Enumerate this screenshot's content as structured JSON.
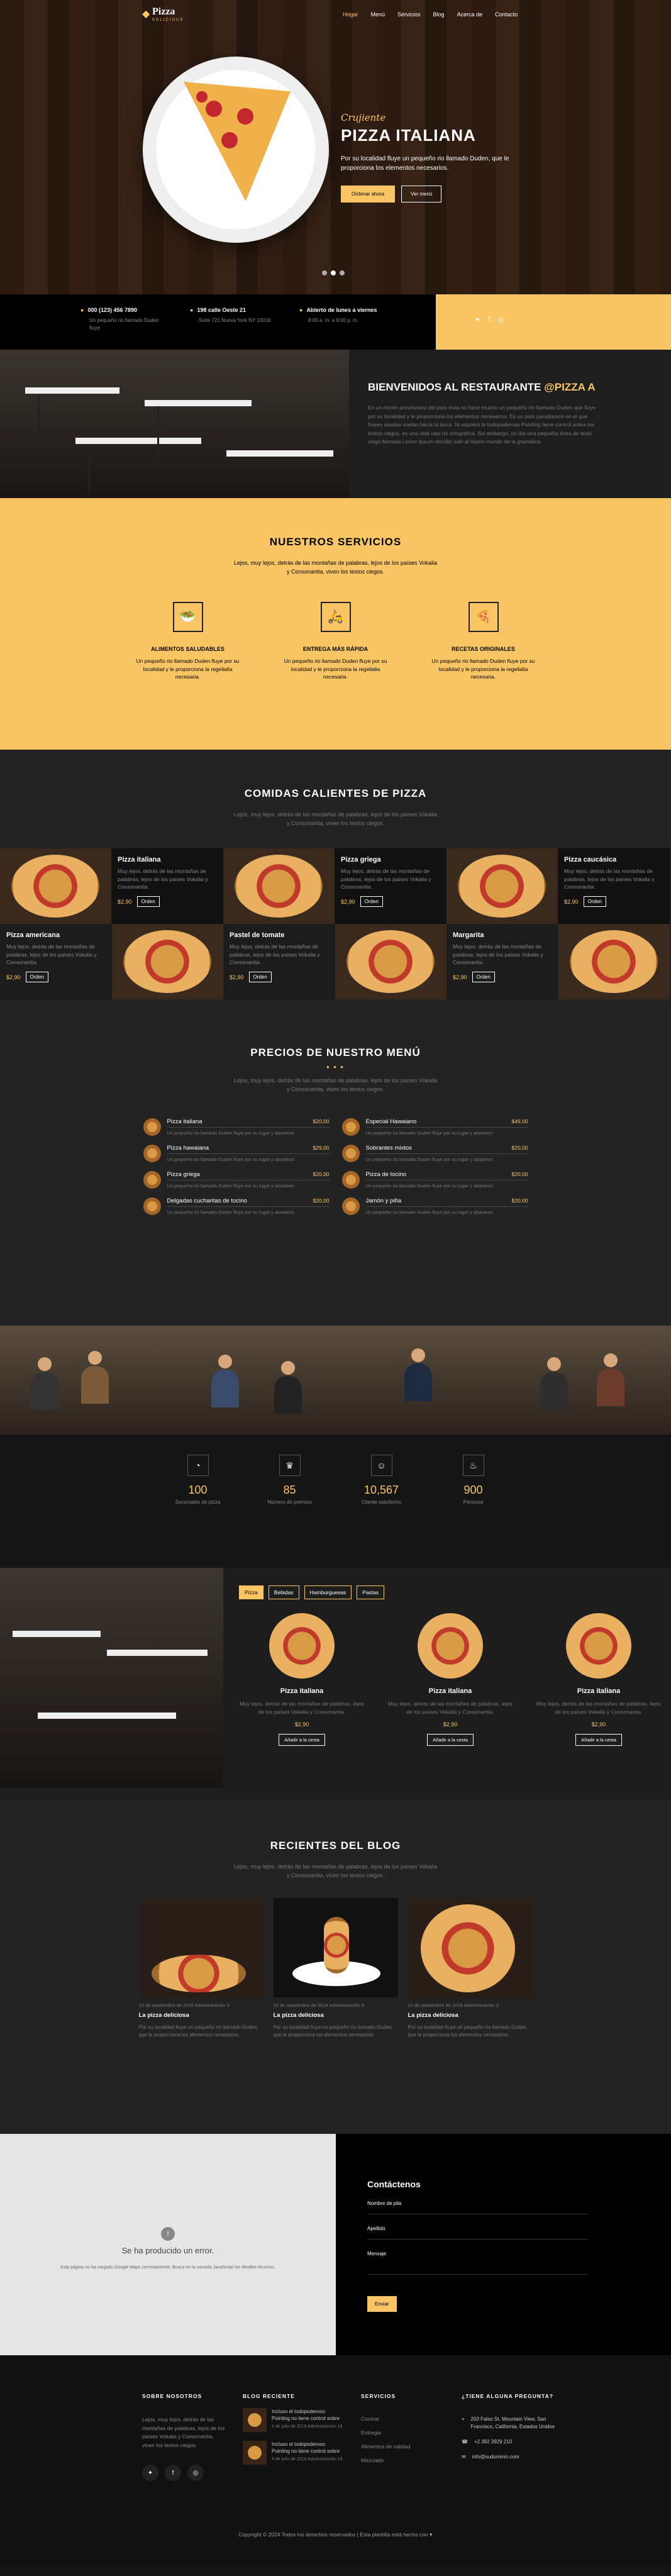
{
  "nav": {
    "logo": "Pizza",
    "logo_sub": "DELICIOUS",
    "items": [
      "Hogar",
      "Menú",
      "Servicios",
      "Blog",
      "Acerca de",
      "Contacto"
    ]
  },
  "hero": {
    "script": "Crujiente",
    "title": "PIZZA ITALIANA",
    "desc": "Por su localidad fluye un pequeño rio llamado Duden, que le proporciona los elementos necesarios.",
    "btn_order": "Ordenar ahora",
    "btn_menu": "Ver menú"
  },
  "info": [
    {
      "title": "000 (123) 456 7890",
      "desc": "Un pequeño rio llamado Duden fluye"
    },
    {
      "title": "198 calle Oeste 21",
      "desc": "Suite 721 Nueva York NY 10016"
    },
    {
      "title": "Abierto de lunes a viernes",
      "desc": "8:00 a. m. a 9:00 p. m."
    }
  ],
  "social_icons": [
    "twitter-icon",
    "facebook-icon",
    "instagram-icon"
  ],
  "welcome": {
    "title": "BIENVENIDOS AL RESTAURANTE",
    "highlight": "@PIZZA A",
    "body": "En un rincón provinciano del país vivía no hace mucho un pequeño río llamado Duden que fluye por su localidad y le proporciona los elementos necesarios. Es un país paradisíaco en el que frases asadas vuelan hacia tu boca. Ni siquiera la todopoderosa Pointing tiene control sobre los textos ciegos, es una vida casi no ortográfica. Sin embargo, un día una pequeña línea de texto ciego llamada Lorem Ipsum decidió salir al lejano mundo de la gramática."
  },
  "services": {
    "title": "NUESTROS SERVICIOS",
    "desc": "Lejos, muy lejos, detrás de las montañas de palabras, lejos de los países Vokalia y Consonantia, viven los textos ciegos.",
    "items": [
      {
        "title": "ALIMENTOS SALUDABLES",
        "desc": "Un pequeño rio llamado Duden fluye por su localidad y le proporciona la regelialia necesaria."
      },
      {
        "title": "ENTREGA MÁS RÁPIDA",
        "desc": "Un pequeño rio llamado Duden fluye por su localidad y le proporciona la regelialia necesaria."
      },
      {
        "title": "RECETAS ORIGINALES",
        "desc": "Un pequeño rio llamado Duden fluye por su localidad y le proporciona la regelialia necesaria."
      }
    ]
  },
  "hot": {
    "title": "COMIDAS CALIENTES DE PIZZA",
    "desc": "Lejos, muy lejos, detrás de las montañas de palabras, lejos de los países Vokalia y Consonantia, viven los textos ciegos.",
    "row1": [
      {
        "name": "Pizza italiana",
        "desc": "Muy lejos, detrás de las montañas de palabras, lejos de los países Vokalia y Consonantia.",
        "price": "$2,90",
        "btn": "Orden"
      },
      {
        "name": "Pizza griega",
        "desc": "Muy lejos, detrás de las montañas de palabras, lejos de los países Vokalia y Consonantia.",
        "price": "$2,90",
        "btn": "Orden"
      },
      {
        "name": "Pizza caucásica",
        "desc": "Muy lejos, detrás de las montañas de palabras, lejos de los países Vokalia y Consonantia.",
        "price": "$2,90",
        "btn": "Orden"
      }
    ],
    "row2": [
      {
        "name": "Pizza americana",
        "desc": "Muy lejos, detrás de las montañas de palabras, lejos de los países Vokalia y Consonantia.",
        "price": "$2,90",
        "btn": "Orden"
      },
      {
        "name": "Pastel de tomate",
        "desc": "Muy lejos, detrás de las montañas de palabras, lejos de los países Vokalia y Consonantia.",
        "price": "$2,90",
        "btn": "Orden"
      },
      {
        "name": "Margarita",
        "desc": "Muy lejos, detrás de las montañas de palabras, lejos de los países Vokalia y Consonantia.",
        "price": "$2,90",
        "btn": "Orden"
      }
    ]
  },
  "prices": {
    "title": "PRECIOS DE NUESTRO MENÚ",
    "desc": "Lejos, muy lejos, detrás de las montañas de palabras, lejos de los países Vokalia y Consonantia, viven los textos ciegos.",
    "left": [
      {
        "name": "Pizza italiana",
        "price": "$20,00",
        "desc": "Un pequeño rio llamado Duden fluye por su lugar y abastece."
      },
      {
        "name": "Pizza hawaiana",
        "price": "$29,00",
        "desc": "Un pequeño rio llamado Duden fluye por su lugar y abastece."
      },
      {
        "name": "Pizza griega",
        "price": "$20,00",
        "desc": "Un pequeño rio llamado Duden fluye por su lugar y abastece."
      },
      {
        "name": "Delgadas cucharitas de tocino",
        "price": "$20,00",
        "desc": "Un pequeño rio llamado Duden fluye por su lugar y abastece."
      }
    ],
    "right": [
      {
        "name": "Especial Hawaiano",
        "price": "$49,00",
        "desc": "Un pequeño rio llamado Duden fluye por su lugar y abastece."
      },
      {
        "name": "Sobrantes mixtos",
        "price": "$20,00",
        "desc": "Un pequeño rio llamado Duden fluye por su lugar y abastece."
      },
      {
        "name": "Pizza de tocino",
        "price": "$20,00",
        "desc": "Un pequeño rio llamado Duden fluye por su lugar y abastece."
      },
      {
        "name": "Jamón y piña",
        "price": "$20,00",
        "desc": "Un pequeño rio llamado Duden fluye por su lugar y abastece."
      }
    ]
  },
  "counters": [
    {
      "number": "100",
      "label": "Sucursales de pizza"
    },
    {
      "number": "85",
      "label": "Número de premios"
    },
    {
      "number": "10,567",
      "label": "Cliente satisfecho"
    },
    {
      "number": "900",
      "label": "Personal"
    }
  ],
  "tabs": {
    "labels": [
      "Pizza",
      "Bebidas",
      "Hamburguesas",
      "Pastas"
    ],
    "products": [
      {
        "name": "Pizza italiana",
        "desc": "Muy lejos, detrás de las montañas de palabras, lejos de los países Vokalia y Consonantia.",
        "price": "$2,90",
        "btn": "Añadir a la cesta"
      },
      {
        "name": "Pizza italiana",
        "desc": "Muy lejos, detrás de las montañas de palabras, lejos de los países Vokalia y Consonantia.",
        "price": "$2,90",
        "btn": "Añadir a la cesta"
      },
      {
        "name": "Pizza italiana",
        "desc": "Muy lejos, detrás de las montañas de palabras, lejos de los países Vokalia y Consonantia.",
        "price": "$2,90",
        "btn": "Añadir a la cesta"
      }
    ]
  },
  "blog": {
    "title": "RECIENTES DEL BLOG",
    "desc": "Lejos, muy lejos, detrás de las montañas de palabras, lejos de los países Vokalia y Consonantia, viven los textos ciegos.",
    "posts": [
      {
        "meta": "10 de septiembre de 2018  Administración  3",
        "title": "La pizza deliciosa",
        "desc": "Por su localidad fluye un pequeño río llamado Duden, que le proporciona los elementos necesarios."
      },
      {
        "meta": "10 de septiembre de 2018  Administración  3",
        "title": "La pizza deliciosa",
        "desc": "Por su localidad fluye un pequeño río llamado Duden, que le proporciona los elementos necesarios."
      },
      {
        "meta": "10 de septiembre de 2018  Administración  3",
        "title": "La pizza deliciosa",
        "desc": "Por su localidad fluye un pequeño río llamado Duden, que le proporciona los elementos necesarios."
      }
    ]
  },
  "map": {
    "error_title": "Se ha producido un error.",
    "error_desc": "Esta página no ha cargado Google Maps correctamente. Busca en la consola JavaScript los detalles técnicos."
  },
  "contact": {
    "title": "Contáctenos",
    "fields": [
      "Nombre de pila",
      "Apellido",
      "Mensaje"
    ],
    "send": "Enviar"
  },
  "footer": {
    "about_title": "SOBRE NOSOTROS",
    "about_desc": "Lejos, muy lejos, detrás de las montañas de palabras, lejos de los países Vokalia y Consonantia, viven los textos ciegos.",
    "blog_title": "BLOG RECIENTE",
    "blog_posts": [
      {
        "title": "Incluso el todopoderoso Pointing no tiene control sobre",
        "meta": "4 de julio de 2018  Administración  19"
      },
      {
        "title": "Incluso el todopoderoso Pointing no tiene control sobre",
        "meta": "4 de julio de 2018  Administración  19"
      }
    ],
    "services_title": "SERVICIOS",
    "services": [
      "Cocinar",
      "Entregar",
      "Alimentos de calidad",
      "Mezclado"
    ],
    "question_title": "¿TIENE ALGUNA PREGUNTA?",
    "address": "203 Falso St. Mountain View, San Francisco, California, Estados Unidos",
    "phone": "+2 392 3929 210",
    "email": "info@sudominio.com",
    "copyright": "Copyright © 2024 Todos los derechos reservados | Esta plantilla está hecha con ♥"
  },
  "colors": {
    "accent": "#fac564",
    "dark": "#151515"
  }
}
